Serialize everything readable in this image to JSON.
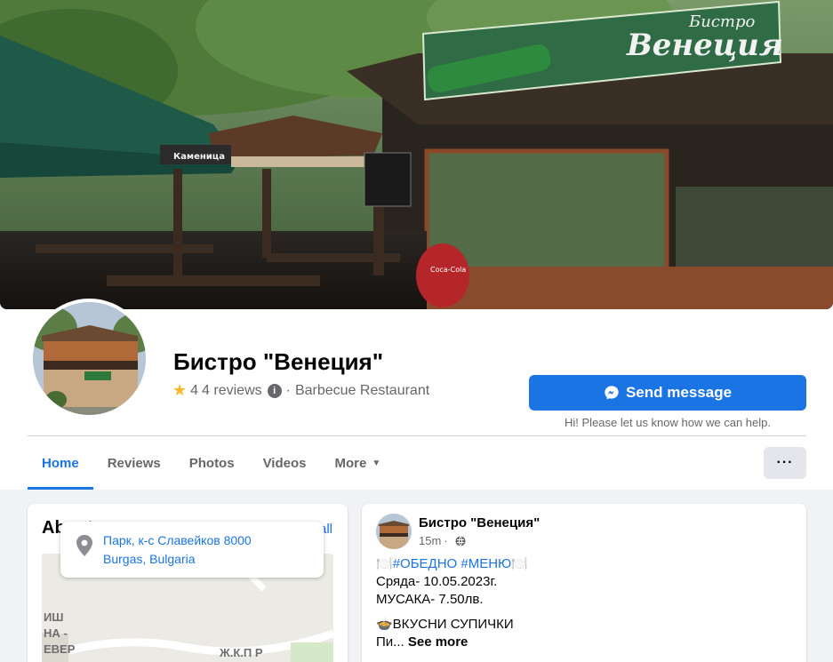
{
  "cover": {
    "sign_title_small": "Бистро",
    "sign_title_big": "Венеция",
    "beer_brand": "Kamenitza",
    "umbrella_brand": "Каменица",
    "coca_cola": "Coca-Cola"
  },
  "profile": {
    "name": "Бистро \"Венеция\"",
    "rating_value": "4",
    "reviews_text": "4 reviews",
    "separator": "·",
    "category": "Barbecue Restaurant"
  },
  "actions": {
    "send_message_label": "Send message",
    "hint_text": "Hi! Please let us know how we can help."
  },
  "tabs": [
    {
      "label": "Home",
      "active": true
    },
    {
      "label": "Reviews"
    },
    {
      "label": "Photos"
    },
    {
      "label": "Videos"
    },
    {
      "label": "More"
    }
  ],
  "more_menu_label": "···",
  "about": {
    "title": "About",
    "see_all": "See all",
    "address_line1": "Парк, к-с Славейков 8000",
    "address_line2": "Burgas, Bulgaria",
    "map_labels": [
      "ИШ",
      "НА -",
      "ЕВЕР",
      "Ж.К.П Р"
    ]
  },
  "post": {
    "author": "Бистро \"Венеция\"",
    "time": "15m",
    "lines": [
      {
        "emoji_left": "🍽️",
        "hashtags": "#ОБЕДНО #МЕНЮ",
        "emoji_right": "🍽️"
      },
      {
        "text": "Сряда- 10.05.2023г."
      },
      {
        "text": "МУСАКА- 7.50лв."
      },
      {
        "text": "🍲ВКУСНИ СУПИЧКИ"
      },
      {
        "text": "Пи...",
        "see_more": "See more"
      }
    ]
  },
  "colors": {
    "accent": "#1b74e4",
    "background": "#f0f2f5",
    "secondary_text": "#65676b",
    "star": "#f7b928"
  }
}
